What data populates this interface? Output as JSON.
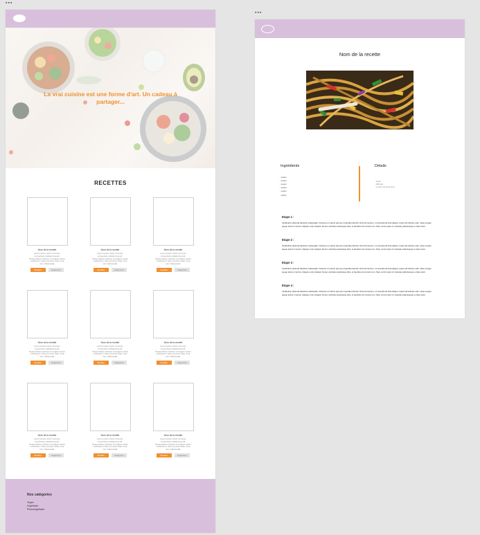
{
  "accent_color": "#f0902f",
  "header_color": "#d8c0dc",
  "frame_labels": {
    "home": "▪▪▪",
    "detail": "▪▪▪"
  },
  "home": {
    "hero_text": "La vrai cuisine est une forme d'art. Un cadeau à partager...",
    "section_title": "RECETTES",
    "cards": [
      {
        "title": "Nom de la recette",
        "desc": "Lorem ipsum dolor sit amet, consectetur adipiscing elit. Suspendisse ultricies id magna varius vestibulum. Nam product vitae urna non malesuada.",
        "btn1": "Modifier",
        "btn2": "Supprimer"
      },
      {
        "title": "Nom de la recette",
        "desc": "Lorem ipsum dolor sit amet, consectetur adipiscing elit. Suspendisse ultricies id magna varius vestibulum. Nam product vitae urna non malesuada.",
        "btn1": "Modifier",
        "btn2": "Supprimer"
      },
      {
        "title": "Nom de la recette",
        "desc": "Lorem ipsum dolor sit amet, consectetur adipiscing elit. Suspendisse ultricies id magna varius vestibulum. Nam product vitae urna non malesuada.",
        "btn1": "Modifier",
        "btn2": "Supprimer"
      },
      {
        "title": "Nom de la recette",
        "desc": "Lorem ipsum dolor sit amet, consectetur adipiscing elit. Suspendisse ultricies id magna varius vestibulum. Nam product vitae urna non malesuada.",
        "btn1": "Modifier",
        "btn2": "Supprimer"
      },
      {
        "title": "Nom de la recette",
        "desc": "Lorem ipsum dolor sit amet, consectetur adipiscing elit. Suspendisse ultricies id magna varius vestibulum. Nam product vitae urna non malesuada.",
        "btn1": "Modifier",
        "btn2": "Supprimer"
      },
      {
        "title": "Nom de la recette",
        "desc": "Lorem ipsum dolor sit amet, consectetur adipiscing elit. Suspendisse ultricies id magna varius vestibulum. Nam product vitae urna non malesuada.",
        "btn1": "Modifier",
        "btn2": "Supprimer"
      },
      {
        "title": "Nom de la recette",
        "desc": "Lorem ipsum dolor sit amet, consectetur adipiscing elit. Suspendisse ultricies id magna varius vestibulum. Nam product vitae urna non malesuada.",
        "btn1": "Modifier",
        "btn2": "Supprimer"
      },
      {
        "title": "Nom de la recette",
        "desc": "Lorem ipsum dolor sit amet, consectetur adipiscing elit. Suspendisse ultricies id magna varius vestibulum. Nam product vitae urna non malesuada.",
        "btn1": "Modifier",
        "btn2": "Supprimer"
      },
      {
        "title": "Nom de la recette",
        "desc": "Lorem ipsum dolor sit amet, consectetur adipiscing elit. Suspendisse ultricies id magna varius vestibulum. Nam product vitae urna non malesuada.",
        "btn1": "Modifier",
        "btn2": "Supprimer"
      }
    ],
    "footer": {
      "title": "Nos catégories",
      "items": [
        "Vegan",
        "Végétarien",
        "Pescovégétarien"
      ]
    }
  },
  "detail": {
    "recipe_title": "Nom de la recette",
    "ingredients_title": "Ingrédients",
    "ingredients": [
      "- Lorem",
      "- Lorem",
      "- Lorem",
      "- Lorem",
      "- Lorem",
      "- Lorem"
    ],
    "details_title": "Détails",
    "details": [
      "- durée",
      "- difficulté",
      "- nombre de personnes"
    ],
    "steps": [
      {
        "label": "Etape 1 :",
        "text": "Vestibulum placerat faucibus malesuada. Vivamus et mauris quis leo imperdiet lobortis. Duis fermentum, mi suscipit elit tinia aliquet, turpis elit ultricies odio, vitae congue augue lectus in lectus. Aliquam erat volutpat. Donec vehicula scelerisque felis, et faucibus dui viverra non. Nam vel dui quis mi molestie pellentesque a vitae tortor."
      },
      {
        "label": "Etape 2 :",
        "text": "Vestibulum placerat faucibus malesuada. Vivamus et mauris quis leo imperdiet lobortis. Duis fermentum, mi suscipit elit tinia aliquet, turpis elit ultricies odio, vitae congue augue lectus in lectus. Aliquam erat volutpat. Donec vehicula scelerisque felis, et faucibus dui viverra non. Nam vel dui quis mi molestie pellentesque a vitae tortor."
      },
      {
        "label": "Etape 3 :",
        "text": "Vestibulum placerat faucibus malesuada. Vivamus et mauris quis leo imperdiet lobortis. Duis fermentum, mi suscipit elit tinia aliquet, turpis elit ultricies odio, vitae congue augue lectus in lectus. Aliquam erat volutpat. Donec vehicula scelerisque felis, et faucibus dui viverra non. Nam vel dui quis mi molestie pellentesque a vitae tortor."
      },
      {
        "label": "Etape 4 :",
        "text": "Vestibulum placerat faucibus malesuada. Vivamus et mauris quis leo imperdiet lobortis. Duis fermentum, mi suscipit elit tinia aliquet, turpis elit ultricies odio, vitae congue augue lectus in lectus. Aliquam erat volutpat. Donec vehicula scelerisque felis, et faucibus dui viverra non. Nam vel dui quis mi molestie pellentesque a vitae tortor."
      }
    ]
  }
}
